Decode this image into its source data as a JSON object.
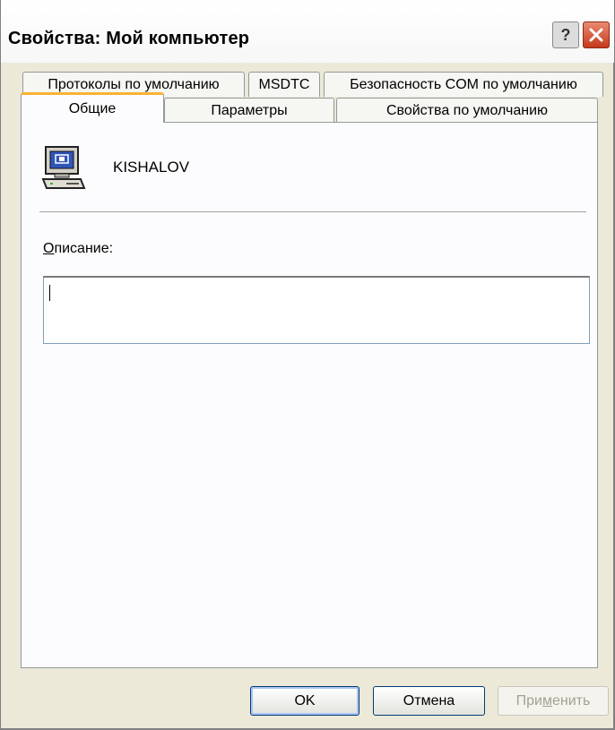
{
  "window": {
    "title": "Свойства: Мой компьютер"
  },
  "titlebar_buttons": {
    "help": "?",
    "close_icon": "close-icon"
  },
  "tabs_back_row": [
    {
      "label": "Протоколы по умолчанию"
    },
    {
      "label": "MSDTC"
    },
    {
      "label": "Безопасность COM по умолчанию"
    }
  ],
  "tabs_front_row": [
    {
      "label": "Общие",
      "active": true
    },
    {
      "label": "Параметры"
    },
    {
      "label": "Свойства по умолчанию"
    }
  ],
  "general": {
    "computer_name": "KISHALOV",
    "description_label_mnemonic": "О",
    "description_label_rest": "писание:",
    "description_value": ""
  },
  "footer": {
    "ok": "OK",
    "cancel": "Отмена",
    "apply_prefix": "При",
    "apply_mnemonic": "м",
    "apply_suffix": "енить"
  },
  "colors": {
    "window_bg": "#ece9d8",
    "panel_bg": "#fcfcfe",
    "active_tab_accent": "#f8b333",
    "close_button": "#c6391c"
  }
}
